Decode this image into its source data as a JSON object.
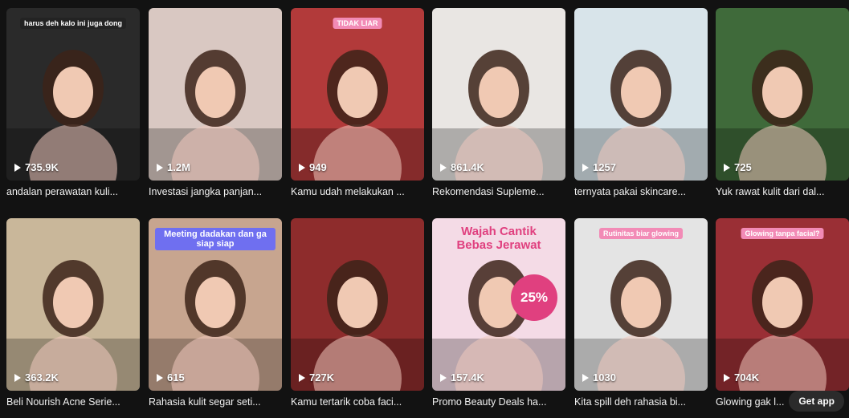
{
  "videos": [
    {
      "views": "735.9K",
      "caption": "andalan perawatan kuli...",
      "overlay": "harus deh kalo ini juga dong",
      "bg": "#2a2a2a"
    },
    {
      "views": "1.2M",
      "caption": "Investasi jangka panjan...",
      "overlay": "",
      "bg": "#d9c8c2"
    },
    {
      "views": "949",
      "caption": "Kamu udah melakukan ...",
      "overlay": "TIDAK LIAR",
      "bg": "#b23a3a"
    },
    {
      "views": "861.4K",
      "caption": "Rekomendasi Supleme...",
      "overlay": "",
      "bg": "#e9e6e3"
    },
    {
      "views": "1257",
      "caption": "ternyata pakai skincare...",
      "overlay": "",
      "bg": "#d8e4ea"
    },
    {
      "views": "725",
      "caption": "Yuk rawat kulit dari dal...",
      "overlay": "",
      "bg": "#3f6a3a"
    },
    {
      "views": "363.2K",
      "caption": "Beli Nourish Acne Serie...",
      "overlay": "",
      "bg": "#c9b79a"
    },
    {
      "views": "615",
      "caption": "Rahasia kulit segar seti...",
      "overlay": "Meeting dadakan dan ga siap siap",
      "bg": "#c7a58f"
    },
    {
      "views": "727K",
      "caption": "Kamu tertarik coba faci...",
      "overlay": "",
      "bg": "#8e2c2c"
    },
    {
      "views": "157.4K",
      "caption": "Promo Beauty Deals ha...",
      "overlay": "Wajah Cantik Bebas Jerawat",
      "bg": "#f4dbe6",
      "promo": "25%"
    },
    {
      "views": "1030",
      "caption": "Kita spill deh rahasia bi...",
      "overlay": "Rutinitas biar glowing",
      "bg": "#e4e4e4"
    },
    {
      "views": "704K",
      "caption": "Glowing gak l...",
      "overlay": "Glowing tanpa facial?",
      "bg": "#9a2f35"
    }
  ],
  "get_app_label": "Get app",
  "colors": {
    "page": "#121212",
    "pill_pink": "#f28bb6",
    "pill_blue": "#6f6ff0"
  }
}
